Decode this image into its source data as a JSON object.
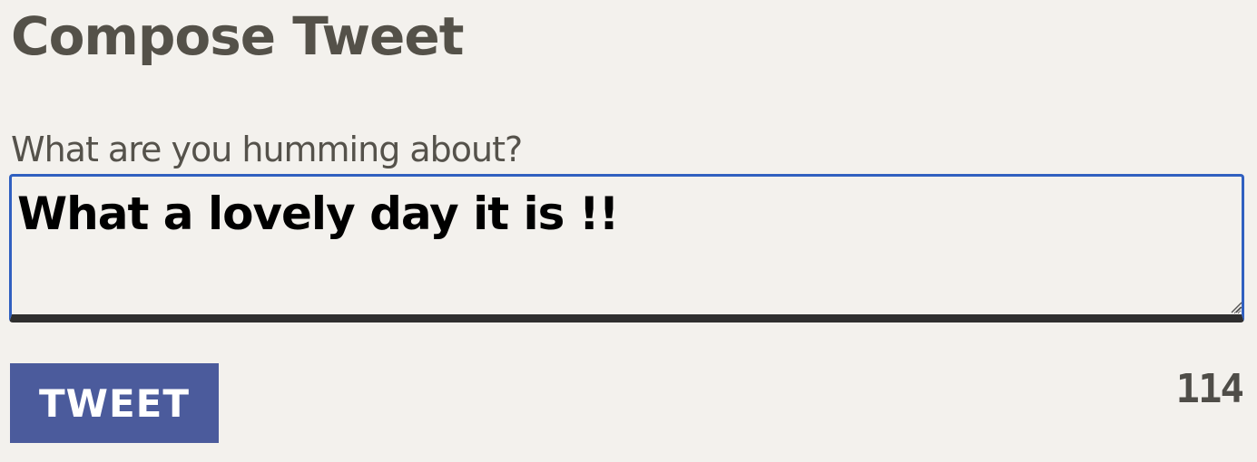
{
  "page": {
    "title": "Compose Tweet"
  },
  "composer": {
    "label": "What are you humming about?",
    "value": "What a lovely day it is !!",
    "char_count": "114"
  },
  "actions": {
    "tweet_label": "TWEET"
  },
  "colors": {
    "background": "#f3f1ed",
    "button": "#4b5b9c",
    "focus_border": "#3060c0",
    "title_text": "#545149"
  },
  "icons": {
    "resize_grip": "resize-grip-icon"
  }
}
